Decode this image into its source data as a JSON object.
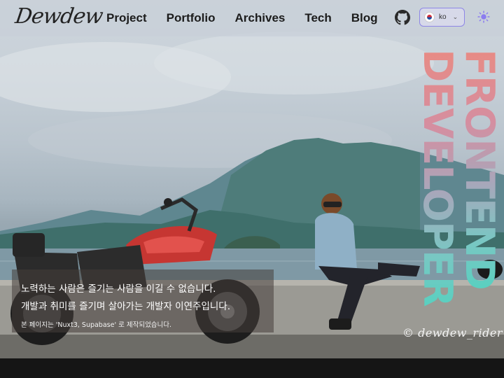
{
  "brand": {
    "logo_text": "Dewdew"
  },
  "nav": {
    "items": [
      {
        "label": "Project"
      },
      {
        "label": "Portfolio"
      },
      {
        "label": "Archives"
      },
      {
        "label": "Tech"
      },
      {
        "label": "Blog"
      }
    ],
    "github_icon": "github-icon",
    "language": {
      "selected": "ko",
      "flag_icon": "korea-flag-icon",
      "chevron_icon": "chevron-down-icon"
    },
    "theme_icon": "sun-icon"
  },
  "hero": {
    "vertical_title_line1": "FRONTEND",
    "vertical_title_line2": "DEVELOPER",
    "intro_line1": "노력하는 사람은 즐기는 사람을 이길 수 없습니다.",
    "intro_line2": "개발과 취미를 즐기며 살아가는 개발자 이연주입니다.",
    "intro_note": "본 페이지는 'Nuxt3, Supabase' 로 제작되었습니다.",
    "watermark": "© dewdew_rider"
  },
  "colors": {
    "accent": "#8e86e6",
    "title_gradient_top": "#e88b84",
    "title_gradient_bottom": "#59d0c0"
  }
}
